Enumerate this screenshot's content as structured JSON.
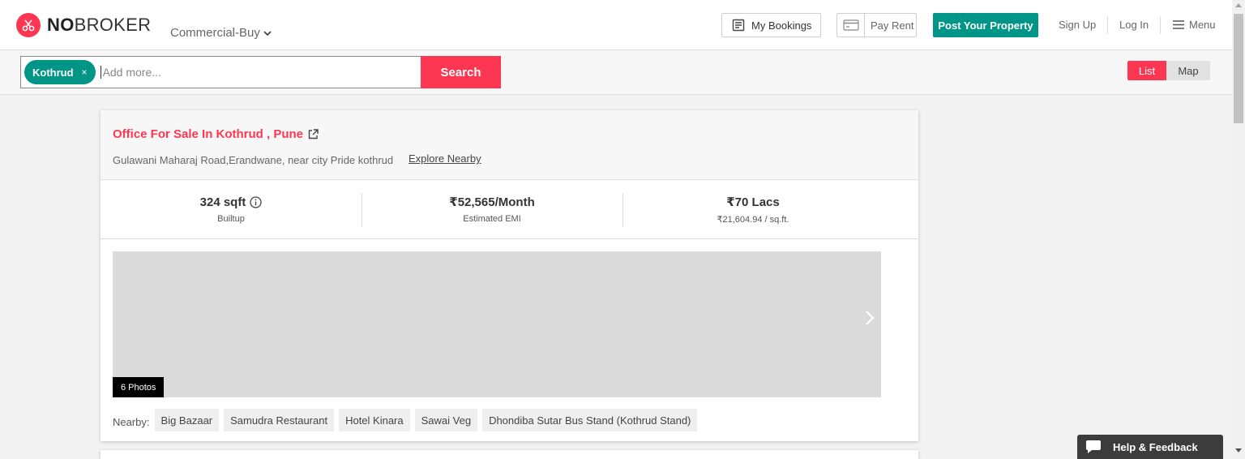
{
  "header": {
    "logo_strong": "NO",
    "logo_rest": "BROKER",
    "category": "Commercial-Buy",
    "my_bookings": "My Bookings",
    "pay_rent": "Pay Rent",
    "post_property": "Post Your Property",
    "sign_up": "Sign Up",
    "log_in": "Log In",
    "menu": "Menu"
  },
  "search": {
    "chip": "Kothrud",
    "chip_remove": "×",
    "placeholder": "Add more...",
    "button": "Search"
  },
  "view_toggle": {
    "list": "List",
    "map": "Map",
    "active": "List"
  },
  "listing": {
    "title": "Office For Sale In Kothrud , Pune",
    "address": "Gulawani Maharaj Road,Erandwane, near city Pride kothrud",
    "explore": "Explore Nearby",
    "stats": [
      {
        "value": "324 sqft",
        "label": "Builtup"
      },
      {
        "value": "₹52,565/Month",
        "label": "Estimated EMI"
      },
      {
        "value": "₹70 Lacs",
        "label": "₹21,604.94 / sq.ft."
      }
    ],
    "photo_count": "6 Photos",
    "nearby_label": "Nearby:",
    "nearby": [
      "Big Bazaar",
      "Samudra Restaurant",
      "Hotel Kinara",
      "Sawai Veg",
      "Dhondiba Sutar Bus Stand (Kothrud Stand)"
    ]
  },
  "help": "Help & Feedback",
  "colors": {
    "brand": "#fd3752",
    "teal": "#009587"
  }
}
